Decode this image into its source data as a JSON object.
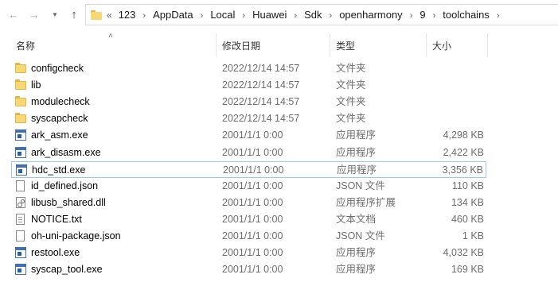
{
  "address_bar": {
    "overflow": "«",
    "crumbs": [
      "123",
      "AppData",
      "Local",
      "Huawei",
      "Sdk",
      "openharmony",
      "9",
      "toolchains"
    ],
    "separator": "›"
  },
  "nav": {
    "back_icon": "arrow-left-icon",
    "forward_icon": "arrow-right-icon",
    "recent_icon": "chevron-down-icon",
    "up_icon": "arrow-up-icon"
  },
  "columns": {
    "name": "名称",
    "date": "修改日期",
    "type": "类型",
    "size": "大小"
  },
  "files": [
    {
      "name": "configcheck",
      "date": "2022/12/14 14:57",
      "type": "文件夹",
      "size": "",
      "icon": "folder-icon"
    },
    {
      "name": "lib",
      "date": "2022/12/14 14:57",
      "type": "文件夹",
      "size": "",
      "icon": "folder-icon"
    },
    {
      "name": "modulecheck",
      "date": "2022/12/14 14:57",
      "type": "文件夹",
      "size": "",
      "icon": "folder-icon"
    },
    {
      "name": "syscapcheck",
      "date": "2022/12/14 14:57",
      "type": "文件夹",
      "size": "",
      "icon": "folder-icon"
    },
    {
      "name": "ark_asm.exe",
      "date": "2001/1/1 0:00",
      "type": "应用程序",
      "size": "4,298 KB",
      "icon": "exe-icon"
    },
    {
      "name": "ark_disasm.exe",
      "date": "2001/1/1 0:00",
      "type": "应用程序",
      "size": "2,422 KB",
      "icon": "exe-icon"
    },
    {
      "name": "hdc_std.exe",
      "date": "2001/1/1 0:00",
      "type": "应用程序",
      "size": "3,356 KB",
      "icon": "exe-icon",
      "selected": true
    },
    {
      "name": "id_defined.json",
      "date": "2001/1/1 0:00",
      "type": "JSON 文件",
      "size": "110 KB",
      "icon": "document-icon"
    },
    {
      "name": "libusb_shared.dll",
      "date": "2001/1/1 0:00",
      "type": "应用程序扩展",
      "size": "134 KB",
      "icon": "dll-icon"
    },
    {
      "name": "NOTICE.txt",
      "date": "2001/1/1 0:00",
      "type": "文本文档",
      "size": "460 KB",
      "icon": "text-file-icon"
    },
    {
      "name": "oh-uni-package.json",
      "date": "2001/1/1 0:00",
      "type": "JSON 文件",
      "size": "1 KB",
      "icon": "document-icon"
    },
    {
      "name": "restool.exe",
      "date": "2001/1/1 0:00",
      "type": "应用程序",
      "size": "4,032 KB",
      "icon": "exe-icon"
    },
    {
      "name": "syscap_tool.exe",
      "date": "2001/1/1 0:00",
      "type": "应用程序",
      "size": "169 KB",
      "icon": "exe-icon"
    }
  ],
  "colors": {
    "folder": "#f8d775",
    "exe_accent": "#3f6fb5",
    "selection_border": "#99c9ef",
    "secondary_text": "#6d6d6d"
  }
}
